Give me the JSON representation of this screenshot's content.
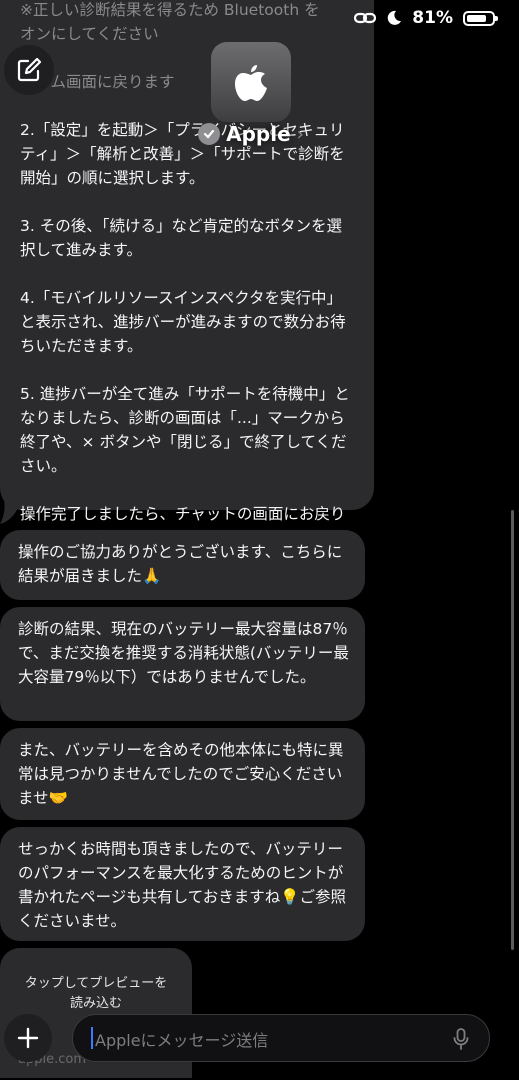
{
  "status": {
    "battery_percent": "81%",
    "battery_level": 0.81
  },
  "header": {
    "contact_name": "Apple"
  },
  "messages": {
    "top": {
      "faded_lines": "※正しい診断結果を得るため Bluetooth を\nオンにしてください\n\nホーム画面に戻ります",
      "body": "2.「設定」を起動＞「プライバシーとセキュリティ」＞「解析と改善」＞「サポートで診断を開始」の順に選択します。\n\n3. その後、「続ける」など肯定的なボタンを選択して進みます。\n\n4.「モバイルリソースインスペクタを実行中」と表示され、進捗バーが進みますので数分お待ちいただきます。\n\n5. 進捗バーが全て進み「サポートを待機中」となりましたら、診断の画面は「...」マークから終了や、× ボタンや「閉じる」で終了してください。\n\n操作完了しましたら、チャットの画面にお戻りになり、お知らせくださいませ。"
    },
    "items": [
      {
        "text": "操作のご協力ありがとうございます、こちらに結果が届きました🙏"
      },
      {
        "text": "診断の結果、現在のバッテリー最大容量は87％で、まだ交換を推奨する消耗状態(バッテリー最大容量79％以下）ではありませんでした。"
      },
      {
        "text": "また、バッテリーを含めその他本体にも特に異常は見つかりませんでしたのでご安心くださいませ🤝"
      },
      {
        "text": "せっかくお時間も頂きましたので、バッテリーのパフォーマンスを最大化するためのヒントが書かれたページも共有しておきますね💡ご参照くださいませ。"
      }
    ],
    "link_preview": {
      "prompt": "タップしてプレビューを読み込む",
      "domain": "apple.com"
    }
  },
  "composer": {
    "placeholder": "Appleにメッセージ送信"
  },
  "colors": {
    "bubble": "#2b2b2e",
    "caret": "#3a7bff",
    "background": "#000000"
  }
}
